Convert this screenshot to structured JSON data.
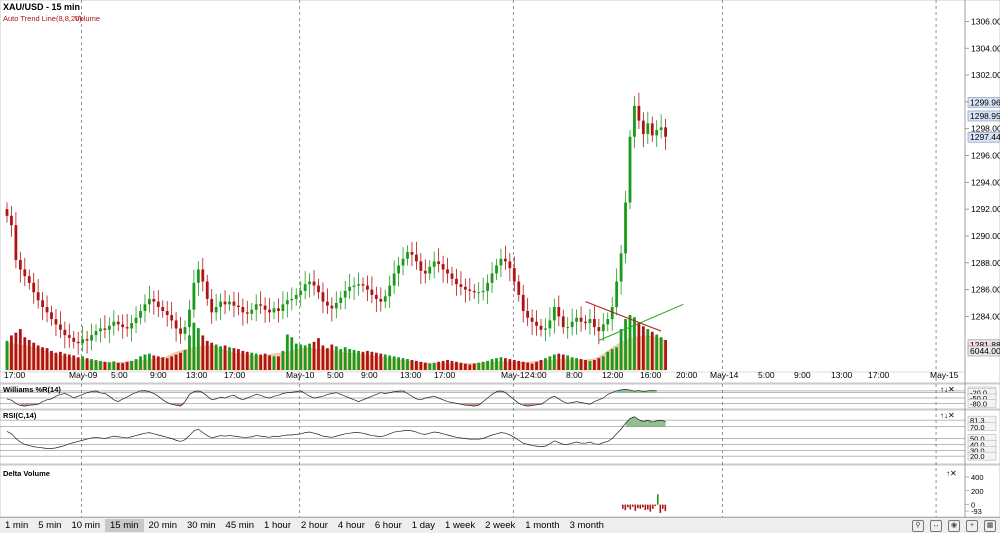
{
  "main": {
    "symbol_title": "XAU/USD - 15 min",
    "overlay_labels": [
      "Auto Trend Line(8,8,20)",
      "Volume"
    ],
    "price_axis": {
      "min": 1280.0,
      "max": 1307.6,
      "ticks": [
        1284,
        1286,
        1288,
        1290,
        1292,
        1294,
        1296,
        1298,
        1300,
        1302,
        1304,
        1306
      ],
      "tick_labels": [
        "1284.00",
        "1286.00",
        "1288.00",
        "1290.00",
        "1292.00",
        "1294.00",
        "1296.00",
        "1298.00",
        "1300.00",
        "1302.00",
        "1304.00",
        "1306.00"
      ],
      "markers": [
        {
          "label": "1299.96",
          "value": 1299.96,
          "color": "#d8e4f6"
        },
        {
          "label": "1298.95",
          "value": 1298.95,
          "color": "#d8e4f6"
        },
        {
          "label": "1297.44",
          "value": 1297.44,
          "color": "#d8e4f6"
        },
        {
          "label": "1281.88",
          "value": 1281.88,
          "color": "#f6dddd"
        },
        {
          "label": "6044.00",
          "value": 6044,
          "color": "#e8e8e8"
        }
      ]
    },
    "time_axis": [
      "May-09",
      "5:00",
      "9:00",
      "13:00",
      "17:00",
      "May-10",
      "5:00",
      "9:00",
      "13:00",
      "17:00",
      "May-12",
      "4:00",
      "8:00",
      "12:00",
      "16:00",
      "20:00",
      "May-14",
      "5:00",
      "9:00",
      "13:00",
      "17:00",
      "May-15"
    ],
    "time_axis_first": "17:00"
  },
  "colors": {
    "up": "#1a9a1a",
    "down": "#b01313",
    "volume_area": "#f5c9a8",
    "trend_green": "#22aa22",
    "trend_red": "#b21d1d",
    "osc_fill": "#8fbf8f",
    "osc_fill_low": "#c89090"
  },
  "chart_data": [
    {
      "type": "line",
      "title": "XAU/USD - 15 min",
      "series": [
        {
          "name": "XAU/USD close",
          "values": [
            1291.5,
            1290.8,
            1288.2,
            1287.5,
            1287.0,
            1286.5,
            1285.8,
            1285.2,
            1284.7,
            1284.3,
            1283.8,
            1283.4,
            1283.0,
            1282.6,
            1282.4,
            1282.1,
            1282.0,
            1282.3,
            1282.2,
            1282.6,
            1282.9,
            1283.1,
            1283.0,
            1283.3,
            1283.6,
            1283.4,
            1283.2,
            1283.1,
            1283.5,
            1283.9,
            1284.4,
            1284.9,
            1285.3,
            1285.1,
            1284.7,
            1284.4,
            1284.1,
            1283.7,
            1283.1,
            1282.7,
            1283.2,
            1284.5,
            1286.5,
            1287.5,
            1286.6,
            1285.3,
            1284.3,
            1284.7,
            1285.1,
            1284.9,
            1285.1,
            1284.8,
            1284.7,
            1284.3,
            1284.2,
            1284.5,
            1284.9,
            1284.8,
            1284.5,
            1284.3,
            1284.6,
            1284.4,
            1284.9,
            1285.2,
            1285.3,
            1285.6,
            1285.9,
            1286.4,
            1286.6,
            1286.3,
            1285.8,
            1285.1,
            1284.8,
            1284.6,
            1285.0,
            1285.4,
            1285.9,
            1286.2,
            1286.3,
            1286.4,
            1286.3,
            1286.0,
            1285.6,
            1285.3,
            1285.1,
            1285.5,
            1286.3,
            1287.2,
            1287.8,
            1288.3,
            1288.8,
            1288.6,
            1288.1,
            1287.4,
            1287.2,
            1287.7,
            1288.1,
            1287.9,
            1287.5,
            1287.2,
            1286.8,
            1286.4,
            1286.2,
            1286.0,
            1285.9,
            1285.8,
            1285.8,
            1285.9,
            1286.5,
            1287.2,
            1287.8,
            1288.3,
            1288.1,
            1287.6,
            1286.6,
            1285.6,
            1284.4,
            1283.9,
            1283.6,
            1283.3,
            1283.0,
            1283.1,
            1283.7,
            1284.7,
            1284.0,
            1283.2,
            1283.2,
            1283.6,
            1283.9,
            1283.6,
            1283.5,
            1283.8,
            1283.2,
            1282.9,
            1283.4,
            1283.8,
            1284.7,
            1286.6,
            1288.7,
            1292.5,
            1297.4,
            1299.7,
            1298.6,
            1297.6,
            1298.4,
            1297.5,
            1297.9,
            1298.1,
            1297.4
          ]
        }
      ],
      "overlays": [
        {
          "name": "Auto Trend Line(8,8,20)",
          "lines": [
            {
              "color": "green",
              "from": [
                "9:00 May-12",
                1282.2
              ],
              "to": [
                "20:00 May-12",
                1284.9
              ]
            },
            {
              "color": "red",
              "from": [
                "9:00 May-12",
                1285.1
              ],
              "to": [
                "14:00 May-12",
                1282.9
              ]
            }
          ]
        }
      ]
    },
    {
      "type": "bar",
      "title": "Volume",
      "series": [
        {
          "name": "Volume",
          "values": [
            3200,
            3800,
            4100,
            4500,
            3600,
            3300,
            3000,
            2700,
            2500,
            2400,
            2100,
            1900,
            2000,
            1800,
            1700,
            1600,
            1400,
            1500,
            1300,
            1200,
            1100,
            1000,
            900,
            850,
            950,
            800,
            750,
            900,
            1000,
            1200,
            1500,
            1700,
            1800,
            1600,
            1500,
            1400,
            1300,
            1500,
            1700,
            1900,
            2200,
            3800,
            5200,
            4600,
            3800,
            3200,
            3000,
            2800,
            2600,
            2700,
            2500,
            2400,
            2300,
            2100,
            2000,
            1900,
            1800,
            1700,
            1800,
            1600,
            1500,
            1500,
            2100,
            3900,
            3600,
            2900,
            2800,
            2700,
            2900,
            3100,
            3500,
            2700,
            2400,
            2800,
            2600,
            2300,
            2500,
            2300,
            2200,
            2100,
            2000,
            2100,
            2000,
            1900,
            1800,
            1700,
            1600,
            1500,
            1400,
            1300,
            1200,
            1100,
            1000,
            900,
            800,
            700,
            800,
            900,
            1000,
            1100,
            1000,
            900,
            800,
            700,
            600,
            700,
            800,
            900,
            1000,
            1200,
            1300,
            1400,
            1300,
            1200,
            1100,
            1000,
            900,
            800,
            700,
            900,
            1100,
            1300,
            1500,
            1700,
            1800,
            1700,
            1600,
            1400,
            1300,
            1200,
            1100,
            1000,
            1100,
            1300,
            1500,
            2000,
            2300,
            2500,
            4500,
            5600,
            6044,
            5800,
            5200,
            4800,
            4500,
            4200,
            3900,
            3600,
            3300
          ]
        }
      ]
    },
    {
      "type": "line",
      "title": "Williams %R(14)",
      "y_ticks": [
        -10.8,
        -20.0,
        -50.0,
        -80.0
      ],
      "y_tick_labels": [
        "-10.8",
        "-20.0",
        "-50.0",
        "-80.0"
      ],
      "ylim": [
        -100,
        0
      ],
      "series": [
        {
          "name": "Williams %R(14)",
          "values": [
            -55,
            -62,
            -80,
            -92,
            -95,
            -90,
            -88,
            -85,
            -70,
            -60,
            -55,
            -40,
            -30,
            -25,
            -35,
            -50,
            -40,
            -30,
            -20,
            -15,
            -10,
            -22,
            -25,
            -40,
            -60,
            -70,
            -55,
            -45,
            -30,
            -20,
            -10,
            -8,
            -15,
            -25,
            -40,
            -60,
            -75,
            -85,
            -90,
            -95,
            -70,
            -30,
            -15,
            -10,
            -20,
            -40,
            -60,
            -55,
            -45,
            -50,
            -40,
            -35,
            -50,
            -60,
            -50,
            -40,
            -30,
            -35,
            -45,
            -50,
            -40,
            -35,
            -25,
            -20,
            -18,
            -15,
            -10,
            -25,
            -40,
            -50,
            -45,
            -40,
            -30,
            -25,
            -20,
            -30,
            -40,
            -50,
            -60,
            -70,
            -60,
            -50,
            -40,
            -30,
            -20,
            -25,
            -20,
            -15,
            -12,
            -10,
            -25,
            -40,
            -55,
            -60,
            -50,
            -45,
            -40,
            -50,
            -60,
            -70,
            -75,
            -80,
            -85,
            -90,
            -92,
            -95,
            -90,
            -70,
            -50,
            -30,
            -15,
            -10,
            -20,
            -40,
            -60,
            -80,
            -90,
            -95,
            -92,
            -88,
            -85,
            -70,
            -50,
            -40,
            -55,
            -70,
            -80,
            -75,
            -70,
            -75,
            -80,
            -85,
            -70,
            -60,
            -50,
            -30,
            -20,
            -10,
            -5,
            -2,
            -6,
            -12,
            -8,
            -15,
            -10,
            -8,
            -10
          ]
        }
      ]
    },
    {
      "type": "line",
      "title": "RSI(C,14)",
      "y_ticks": [
        81.3,
        70.0,
        50.0,
        40.0,
        30.0,
        20.0
      ],
      "y_tick_labels": [
        "81.3",
        "70.0",
        "50.0",
        "40.0",
        "30.0",
        "20.0"
      ],
      "ylim": [
        10,
        90
      ],
      "series": [
        {
          "name": "RSI(C,14)",
          "values": [
            62,
            58,
            50,
            44,
            40,
            38,
            36,
            35,
            34,
            33,
            33,
            34,
            36,
            38,
            41,
            43,
            45,
            47,
            49,
            51,
            52,
            51,
            50,
            52,
            54,
            53,
            52,
            51,
            53,
            55,
            57,
            59,
            60,
            58,
            56,
            54,
            52,
            50,
            47,
            45,
            48,
            55,
            63,
            66,
            60,
            55,
            51,
            53,
            55,
            54,
            55,
            54,
            53,
            52,
            52,
            53,
            55,
            54,
            53,
            52,
            54,
            53,
            55,
            56,
            56,
            57,
            58,
            60,
            61,
            59,
            57,
            54,
            53,
            52,
            54,
            56,
            58,
            59,
            60,
            60,
            59,
            57,
            55,
            54,
            53,
            55,
            58,
            61,
            62,
            63,
            64,
            63,
            61,
            58,
            57,
            59,
            61,
            60,
            58,
            56,
            54,
            52,
            51,
            50,
            49,
            49,
            49,
            50,
            53,
            56,
            58,
            60,
            59,
            56,
            52,
            47,
            42,
            40,
            38,
            37,
            36,
            37,
            41,
            46,
            43,
            40,
            40,
            42,
            44,
            42,
            42,
            44,
            41,
            40,
            43,
            45,
            50,
            58,
            66,
            76,
            84,
            87,
            82,
            79,
            81,
            78,
            80,
            81,
            79
          ]
        }
      ]
    },
    {
      "type": "bar",
      "title": "Delta Volume",
      "y_ticks": [
        400,
        200,
        0,
        -93
      ],
      "y_tick_labels": [
        "400",
        "200",
        "0",
        "-93"
      ],
      "ylim": [
        -150,
        500
      ],
      "series": [
        {
          "name": "Delta Volume",
          "values": [
            -60,
            -80,
            -40,
            -70,
            -30,
            -90,
            -50,
            -60,
            -40,
            -80,
            -70,
            -100,
            -60,
            -20,
            150,
            -120,
            -60,
            -93
          ]
        }
      ]
    }
  ],
  "timeframe_bar": {
    "items": [
      "1 min",
      "5 min",
      "10 min",
      "15 min",
      "20 min",
      "30 min",
      "45 min",
      "1 hour",
      "2 hour",
      "4 hour",
      "6 hour",
      "1 day",
      "1 week",
      "2 week",
      "1 month",
      "3 month"
    ],
    "active": "15 min"
  }
}
